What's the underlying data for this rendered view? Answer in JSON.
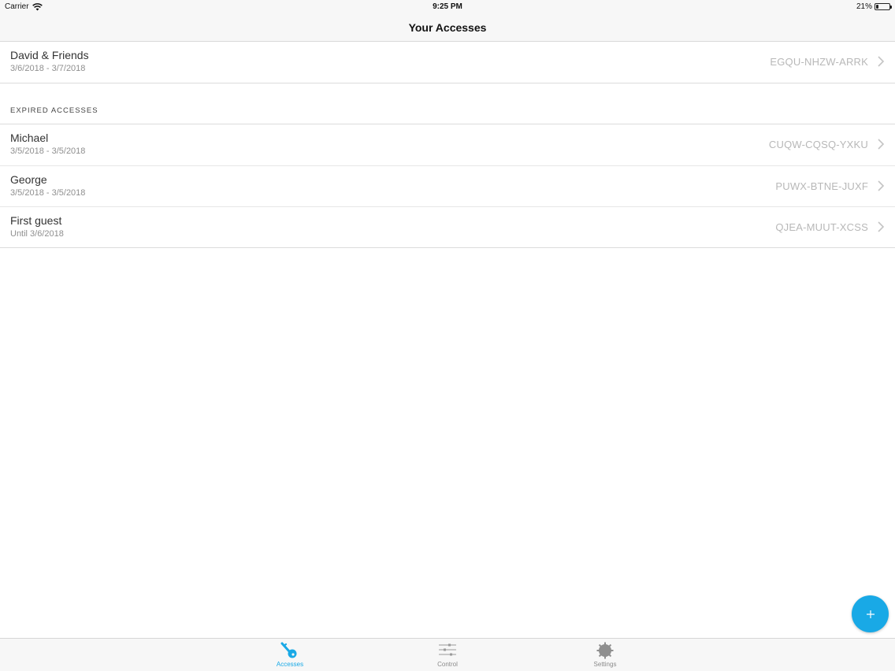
{
  "status_bar": {
    "carrier": "Carrier",
    "time": "9:25 PM",
    "battery_percent": "21%",
    "battery_level": 0.21
  },
  "nav": {
    "title": "Your Accesses"
  },
  "active_accesses": [
    {
      "name": "David & Friends",
      "dates": "3/6/2018 - 3/7/2018",
      "code": "EGQU-NHZW-ARRK"
    }
  ],
  "expired_section": {
    "header": "EXPIRED ACCESSES"
  },
  "expired_accesses": [
    {
      "name": "Michael",
      "dates": "3/5/2018 - 3/5/2018",
      "code": "CUQW-CQSQ-YXKU"
    },
    {
      "name": "George",
      "dates": "3/5/2018 - 3/5/2018",
      "code": "PUWX-BTNE-JUXF"
    },
    {
      "name": "First guest",
      "dates": "Until 3/6/2018",
      "code": "QJEA-MUUT-XCSS"
    }
  ],
  "fab": {
    "icon": "plus-icon"
  },
  "tabs": [
    {
      "label": "Accesses",
      "icon": "key-icon",
      "active": true
    },
    {
      "label": "Control",
      "icon": "sliders-icon",
      "active": false
    },
    {
      "label": "Settings",
      "icon": "gear-icon",
      "active": false
    }
  ],
  "colors": {
    "accent": "#19a9e6",
    "inactive_tab": "#8a8a8a",
    "code_text": "#b8b8b8"
  }
}
